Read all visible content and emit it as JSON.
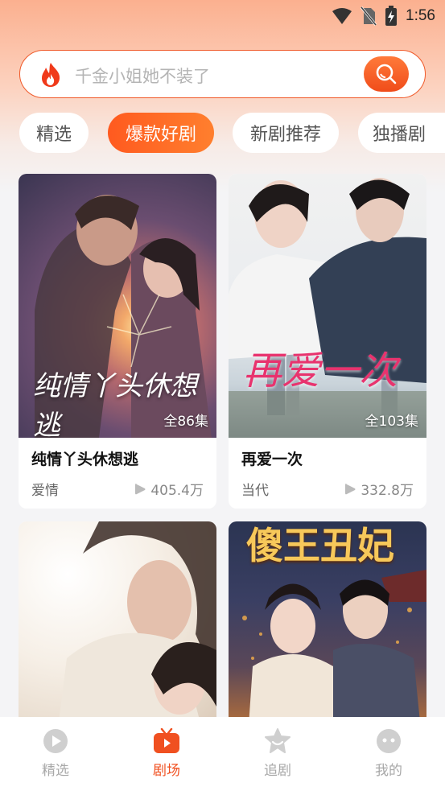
{
  "status_bar": {
    "time": "1:56"
  },
  "search": {
    "placeholder": "千金小姐她不装了"
  },
  "tabs": [
    {
      "label": "精选",
      "active": false
    },
    {
      "label": "爆款好剧",
      "active": true
    },
    {
      "label": "新剧推荐",
      "active": false
    },
    {
      "label": "独播剧",
      "active": false
    }
  ],
  "dramas": [
    {
      "title": "纯情丫头休想逃",
      "genre": "爱情",
      "views": "405.4万",
      "episodes": "全86集",
      "poster_text": "纯情丫头休想逃"
    },
    {
      "title": "再爱一次",
      "genre": "当代",
      "views": "332.8万",
      "episodes": "全103集",
      "poster_text": "再爱一次"
    },
    {
      "poster_text": ""
    },
    {
      "poster_text": "傻王丑妃"
    }
  ],
  "bottom_nav": [
    {
      "label": "精选",
      "icon": "play-circle-icon",
      "active": false
    },
    {
      "label": "剧场",
      "icon": "tv-icon",
      "active": true
    },
    {
      "label": "追剧",
      "icon": "star-icon",
      "active": false
    },
    {
      "label": "我的",
      "icon": "face-icon",
      "active": false
    }
  ],
  "colors": {
    "accent": "#f05a2a",
    "nav_active": "#f05020",
    "nav_inactive": "#a8a8a8"
  }
}
